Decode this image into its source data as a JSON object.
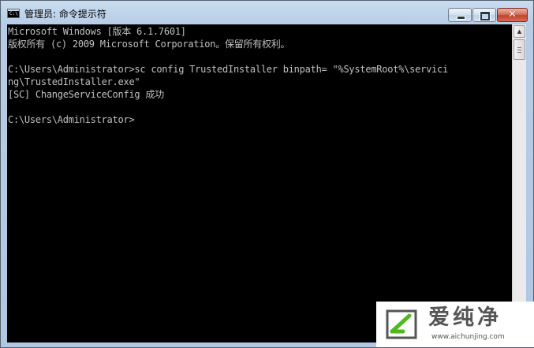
{
  "window": {
    "title": "管理员: 命令提示符",
    "icon_label": "C:\\",
    "controls": {
      "minimize": "minimize-icon",
      "maximize": "maximize-icon",
      "close": "close-icon",
      "close_glyph": "✕"
    }
  },
  "console": {
    "lines": [
      "Microsoft Windows [版本 6.1.7601]",
      "版权所有 (c) 2009 Microsoft Corporation。保留所有权利。",
      "",
      "C:\\Users\\Administrator>sc config TrustedInstaller binpath= \"%SystemRoot%\\servici",
      "ng\\TrustedInstaller.exe\"",
      "[SC] ChangeServiceConfig 成功",
      "",
      "C:\\Users\\Administrator>"
    ],
    "colors": {
      "background": "#000000",
      "text": "#c0c0c0"
    }
  },
  "scrollbar": {
    "up_glyph": "▲",
    "down_glyph": "▼"
  },
  "watermark": {
    "name": "爱纯净",
    "url": "www.aichunjing.com",
    "accent": "#4fb81f"
  }
}
